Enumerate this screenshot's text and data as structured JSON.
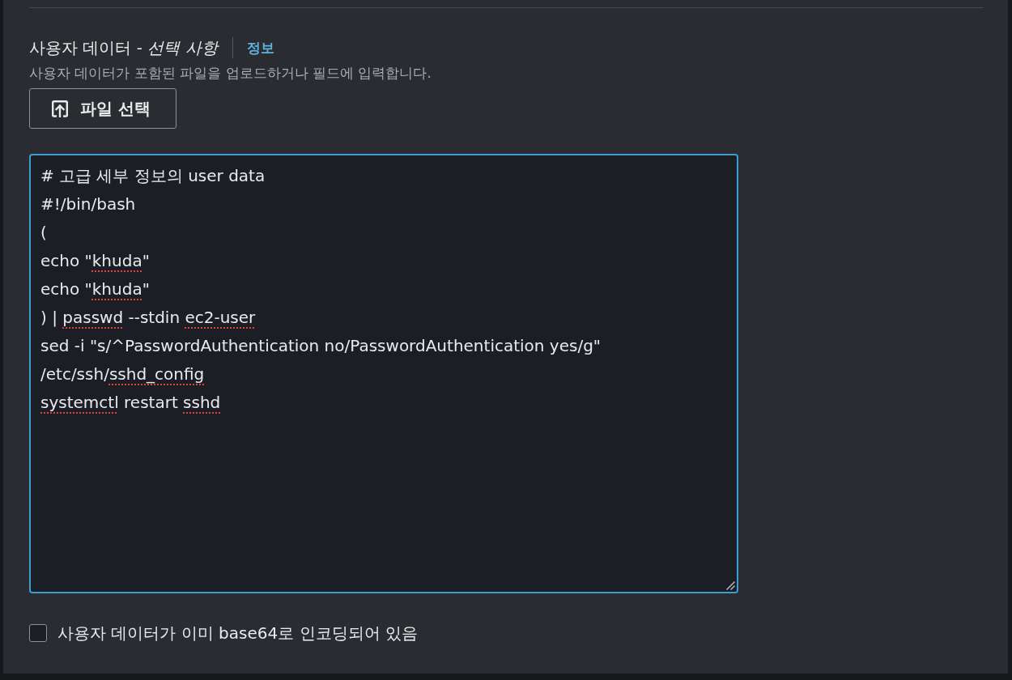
{
  "user_data": {
    "label": "사용자 데이터 - *선택 사항*",
    "info_link": "정보",
    "description": "사용자 데이터가 포함된 파일을 업로드하거나 필드에 입력합니다.",
    "file_button": "파일 선택",
    "editor": {
      "focused": true,
      "lines": [
        {
          "segments": [
            {
              "text": "# 고급 세부 정보의 user data",
              "misspelled": false
            }
          ]
        },
        {
          "segments": [
            {
              "text": "#!/bin/bash",
              "misspelled": false
            }
          ]
        },
        {
          "segments": [
            {
              "text": "(",
              "misspelled": false
            }
          ]
        },
        {
          "segments": [
            {
              "text": "echo \"",
              "misspelled": false
            },
            {
              "text": "khuda",
              "misspelled": true
            },
            {
              "text": "\"",
              "misspelled": false
            }
          ]
        },
        {
          "segments": [
            {
              "text": "echo \"",
              "misspelled": false
            },
            {
              "text": "khuda",
              "misspelled": true
            },
            {
              "text": "\"",
              "misspelled": false
            }
          ]
        },
        {
          "segments": [
            {
              "text": ") | ",
              "misspelled": false
            },
            {
              "text": "passwd",
              "misspelled": true
            },
            {
              "text": " --stdin ",
              "misspelled": false
            },
            {
              "text": "ec2-user",
              "misspelled": true
            }
          ]
        },
        {
          "segments": [
            {
              "text": "sed -i \"s/^PasswordAuthentication no/PasswordAuthentication yes/g\"",
              "misspelled": false
            }
          ]
        },
        {
          "segments": [
            {
              "text": "/etc/ssh/",
              "misspelled": false
            },
            {
              "text": "sshd_config",
              "misspelled": true
            }
          ]
        },
        {
          "segments": [
            {
              "text": "systemctl",
              "misspelled": true
            },
            {
              "text": " restart ",
              "misspelled": false
            },
            {
              "text": "sshd",
              "misspelled": true
            }
          ]
        }
      ]
    },
    "base64_checkbox": {
      "label": "사용자 데이터가 이미 base64로 인코딩되어 있음",
      "checked": false
    }
  }
}
